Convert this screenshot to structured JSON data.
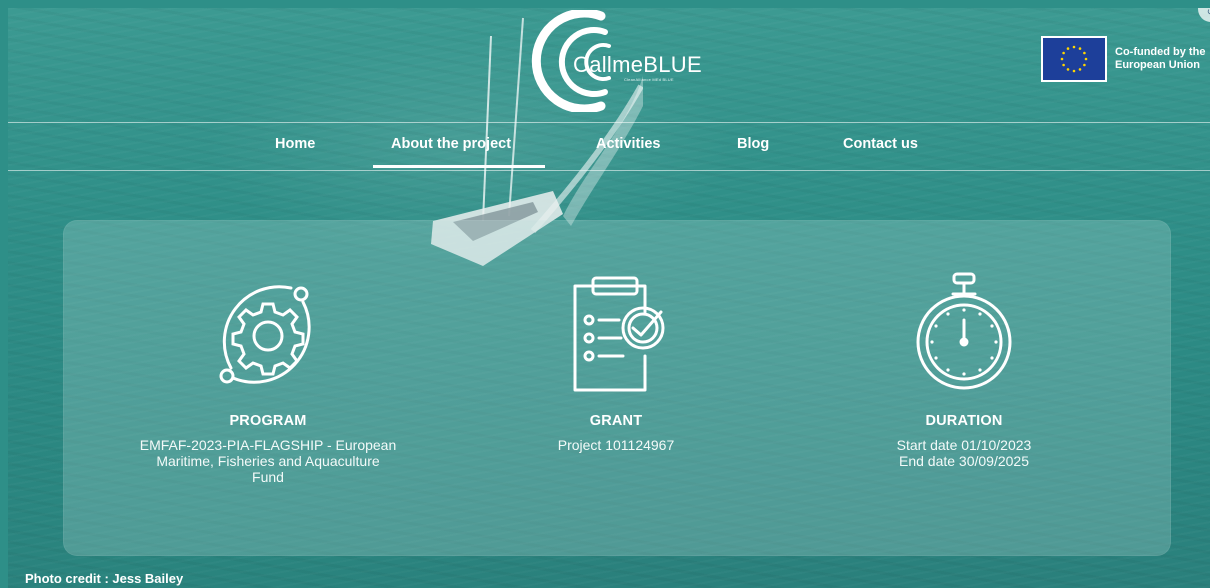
{
  "header": {
    "logo_text": "CallmeBLUE",
    "logo_subtitle": "CleanAlliance MEd BLUE",
    "eu_funding": [
      "Co-funded by the",
      "European Union"
    ]
  },
  "nav": {
    "items": [
      {
        "label": "Home"
      },
      {
        "label": "About the project",
        "active": true
      },
      {
        "label": "Activities"
      },
      {
        "label": "Blog"
      },
      {
        "label": "Contact us"
      }
    ]
  },
  "info": {
    "program": {
      "title": "PROGRAM",
      "lines": [
        "EMFAF-2023-PIA-FLAGSHIP - European",
        "Maritime, Fisheries and Aquaculture",
        "Fund"
      ]
    },
    "grant": {
      "title": "GRANT",
      "lines": [
        "Project 101124967"
      ]
    },
    "duration": {
      "title": "DURATION",
      "lines": [
        "Start date 01/10/2023",
        "End date 30/09/2025"
      ]
    }
  },
  "footer": {
    "photo_credit": "Photo credit : Jess Bailey"
  },
  "colors": {
    "sea": "#2f8f88",
    "eu_blue": "#1d3f9a",
    "eu_star": "#ffd500",
    "text": "#ffffff"
  },
  "icons": [
    "gear-orbit-icon",
    "clipboard-check-icon",
    "stopwatch-icon",
    "eu-flag-icon"
  ]
}
